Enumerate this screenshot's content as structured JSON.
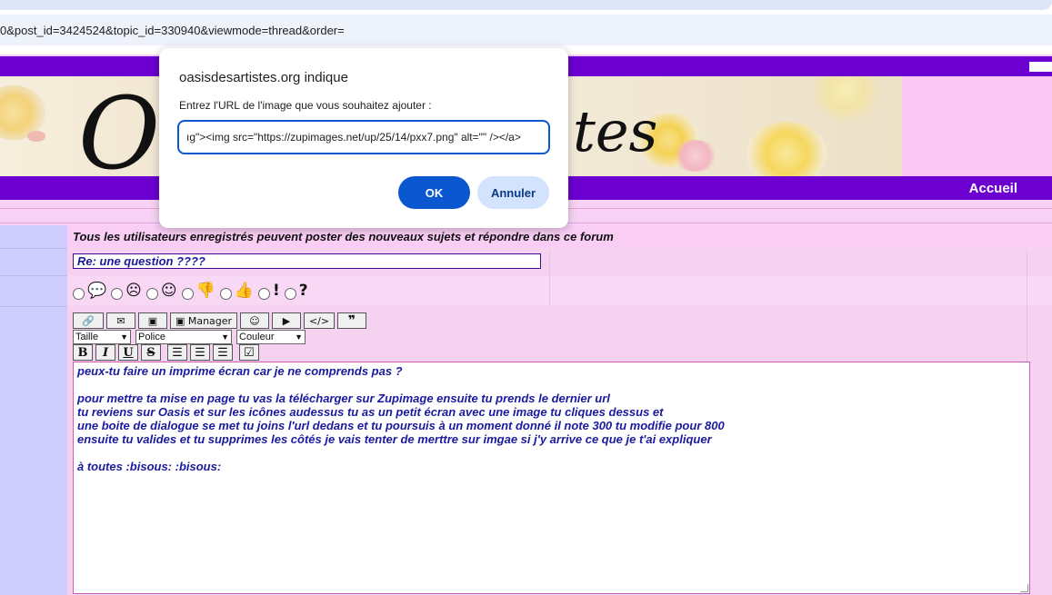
{
  "browser": {
    "url_fragment": "0&post_id=3424524&topic_id=330940&viewmode=thread&order="
  },
  "site": {
    "nav_home": "Accueil",
    "banner_letter_left": "O",
    "banner_letter_right": "tes"
  },
  "form": {
    "notice": "Tous les utilisateurs enregistrés peuvent poster des nouveaux sujets et répondre dans ce forum",
    "subject_value": "Re: une question ????",
    "smileys": [
      "speech-bubble",
      "sad",
      "smile",
      "thumbs-down",
      "thumbs-up",
      "!",
      "?"
    ],
    "toolbar_manager_label": "Manager",
    "select_size": "Taille",
    "select_font": "Police",
    "select_color": "Couleur",
    "format_bold": "B",
    "format_italic": "I",
    "format_underline": "U",
    "format_strike": "S",
    "message_lines": [
      "peux-tu faire un imprime écran car je ne comprends pas ?",
      "",
      "pour mettre ta mise en page tu vas la télécharger sur Zupimage ensuite tu prends le dernier url",
      "tu reviens sur Oasis et sur les icônes audessus tu as un petit écran avec une image tu cliques dessus et",
      "une boite de dialogue se met tu joins l'url dedans et tu poursuis à un moment donné il note 300 tu modifie pour 800",
      "ensuite tu valides et tu supprimes les côtés je vais tenter de merttre sur imgae si j'y arrive ce que je t'ai expliquer",
      "",
      "à toutes :bisous:  :bisous:"
    ]
  },
  "dialog": {
    "title": "oasisdesartistes.org indique",
    "message": "Entrez l'URL de l'image que vous souhaitez ajouter :",
    "input_value": "ıg\"><img src=\"https://zupimages.net/up/25/14/pxx7.png\" alt=\"\" /></a>",
    "ok_label": "OK",
    "cancel_label": "Annuler"
  }
}
